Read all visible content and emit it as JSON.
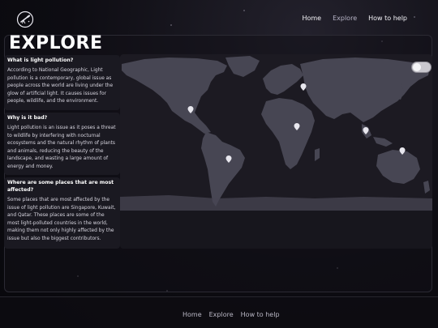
{
  "header": {
    "logo_icon": "telescope-badge-icon",
    "nav": [
      {
        "label": "Home",
        "active": false
      },
      {
        "label": "Explore",
        "active": true
      },
      {
        "label": "How to help",
        "active": false
      }
    ]
  },
  "main": {
    "title": "EXPLORE",
    "cards": [
      {
        "heading": "What is light pollution?",
        "body": "According to National Geographic, Light pollution is a contemporary, global issue as people across the world are living under the glow of artificial light. It causes issues for people, wildlife, and the environment."
      },
      {
        "heading": "Why is it bad?",
        "body": "Light pollution is an issue as it poses a threat to wildlife by interfering with nocturnal ecosystems and the natural rhythm of plants and animals, reducing the beauty of the landscape, and wasting a large amount of energy and money."
      },
      {
        "heading": "Where are some places that are most affected?",
        "body": "Some places that are most affected by the issue of light pollution are Singapore, Kuwait, and Qatar. These places are some of the most light-polluted countries in the world, making them not only highly affected by the issue but also the biggest contributors."
      }
    ],
    "map": {
      "toggle_on": false,
      "marker_icon": "map-pin-icon"
    }
  },
  "footer": {
    "nav": [
      "Home",
      "Explore",
      "How to help"
    ]
  },
  "colors": {
    "background": "#0d0c12",
    "panel": "#1a1921",
    "land": "#3f3e4a",
    "ocean": "#17161d",
    "text": "#e8e6ee"
  }
}
